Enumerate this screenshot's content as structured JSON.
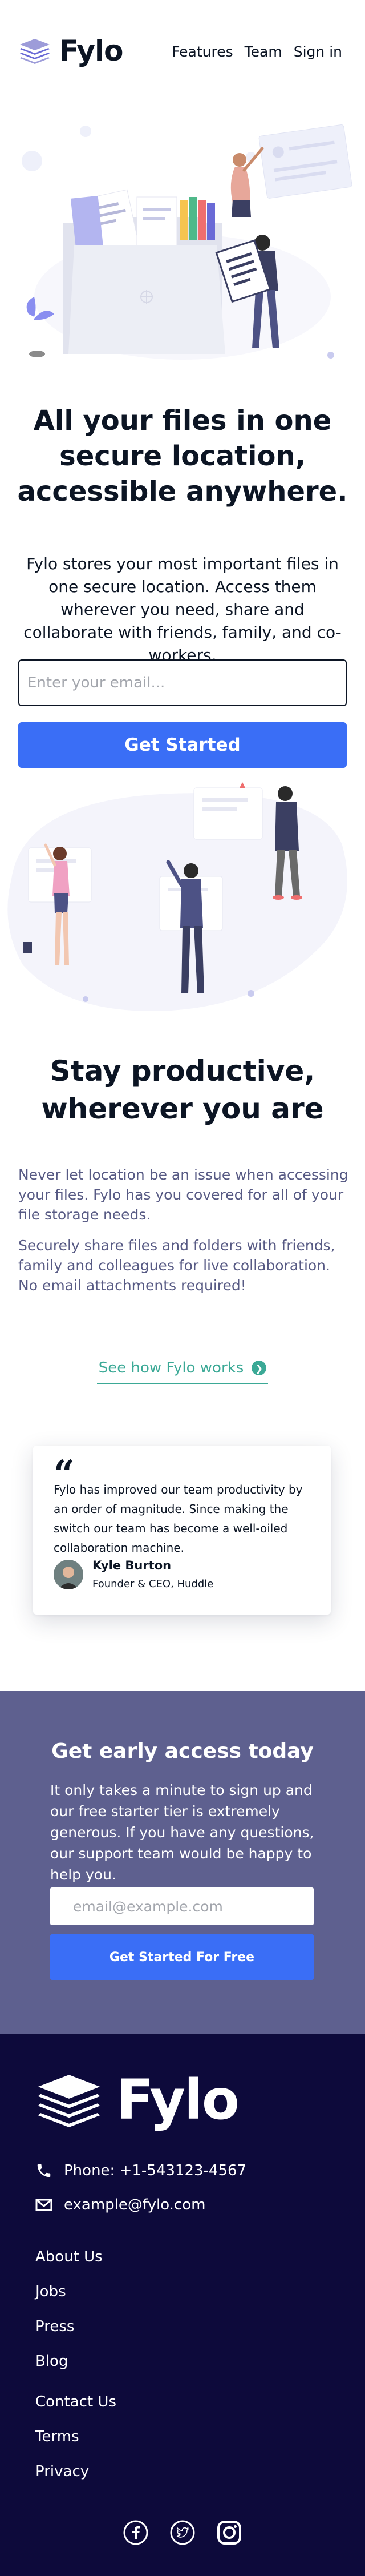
{
  "header": {
    "brand": "Fylo",
    "nav": [
      "Features",
      "Team",
      "Sign in"
    ]
  },
  "hero": {
    "title_lines": [
      "All your files in one",
      "secure location,",
      "accessible anywhere."
    ],
    "text": "Fylo stores your most important files in one secure location. Access them wherever you need, share and collaborate with friends, family, and co-workers.",
    "email_placeholder": "Enter your email...",
    "cta": "Get Started"
  },
  "productive": {
    "title_lines": [
      "Stay productive,",
      "wherever you are"
    ],
    "paragraph1": "Never let location be an issue when accessing your files. Fylo has you covered for all of your file storage needs.",
    "paragraph2": "Securely share files and folders with friends, family and colleagues for live collaboration. No email attachments required!",
    "link": "See how Fylo works"
  },
  "testimonial": {
    "quote": "Fylo has improved our team productivity by an order of magnitude. Since making the switch our team has become a well-oiled collaboration machine.",
    "name": "Kyle Burton",
    "role": "Founder & CEO, Huddle"
  },
  "early_access": {
    "title": "Get early access today",
    "text": "It only takes a minute to sign up and our free starter tier is extremely generous. If you have any questions, our support team would be happy to help you.",
    "email_placeholder": "email@example.com",
    "cta": "Get Started For Free"
  },
  "footer": {
    "brand": "Fylo",
    "phone": "Phone: +1-543123-4567",
    "email": "example@fylo.com",
    "links1": [
      "About Us",
      "Jobs",
      "Press",
      "Blog"
    ],
    "links2": [
      "Contact Us",
      "Terms",
      "Privacy"
    ],
    "social_icons": [
      "facebook-icon",
      "twitter-icon",
      "instagram-icon"
    ]
  },
  "colors": {
    "dark_navy": "#0c1524",
    "primary_blue": "#3a6ef6",
    "teal": "#3ba996",
    "muted_text": "#575a84",
    "early_bg": "#5e608f",
    "footer_bg": "#0d0a3b"
  }
}
